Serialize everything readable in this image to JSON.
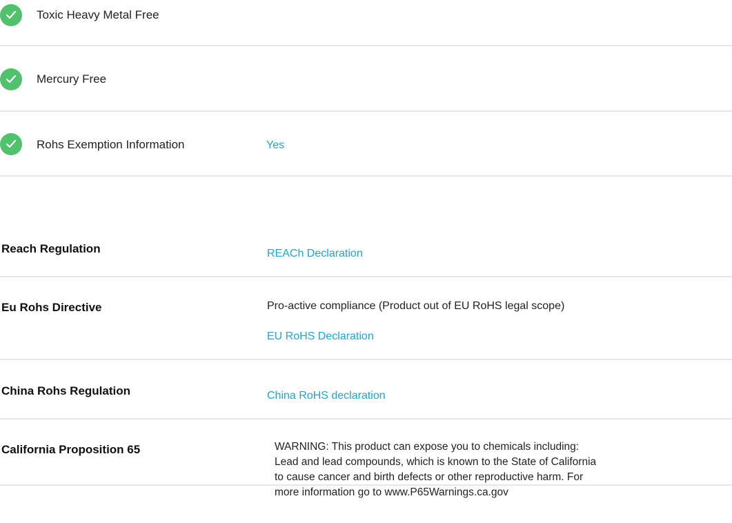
{
  "compliance_checks": [
    {
      "label": "Toxic Heavy Metal Free",
      "value": ""
    },
    {
      "label": "Mercury Free",
      "value": ""
    },
    {
      "label": "Rohs Exemption Information",
      "value": "Yes"
    }
  ],
  "regulations": {
    "reach": {
      "label": "Reach Regulation",
      "link": "REACh Declaration"
    },
    "eu_rohs": {
      "label": "Eu Rohs Directive",
      "text": "Pro-active compliance (Product out of EU RoHS legal scope)",
      "link": "EU RoHS Declaration"
    },
    "china_rohs": {
      "label": "China Rohs Regulation",
      "link": "China RoHS declaration"
    },
    "prop65": {
      "label": "California Proposition 65",
      "text": "WARNING: This product can expose you to chemicals including: Lead and lead compounds, which is known to the State of California to cause cancer and birth defects or other reproductive harm. For more information go to www.P65Warnings.ca.gov"
    }
  },
  "colors": {
    "check_green": "#4fc26b",
    "link_blue": "#1ba6d8",
    "divider": "#e6e6e6"
  },
  "icons": {
    "check": "check-circle-icon"
  }
}
